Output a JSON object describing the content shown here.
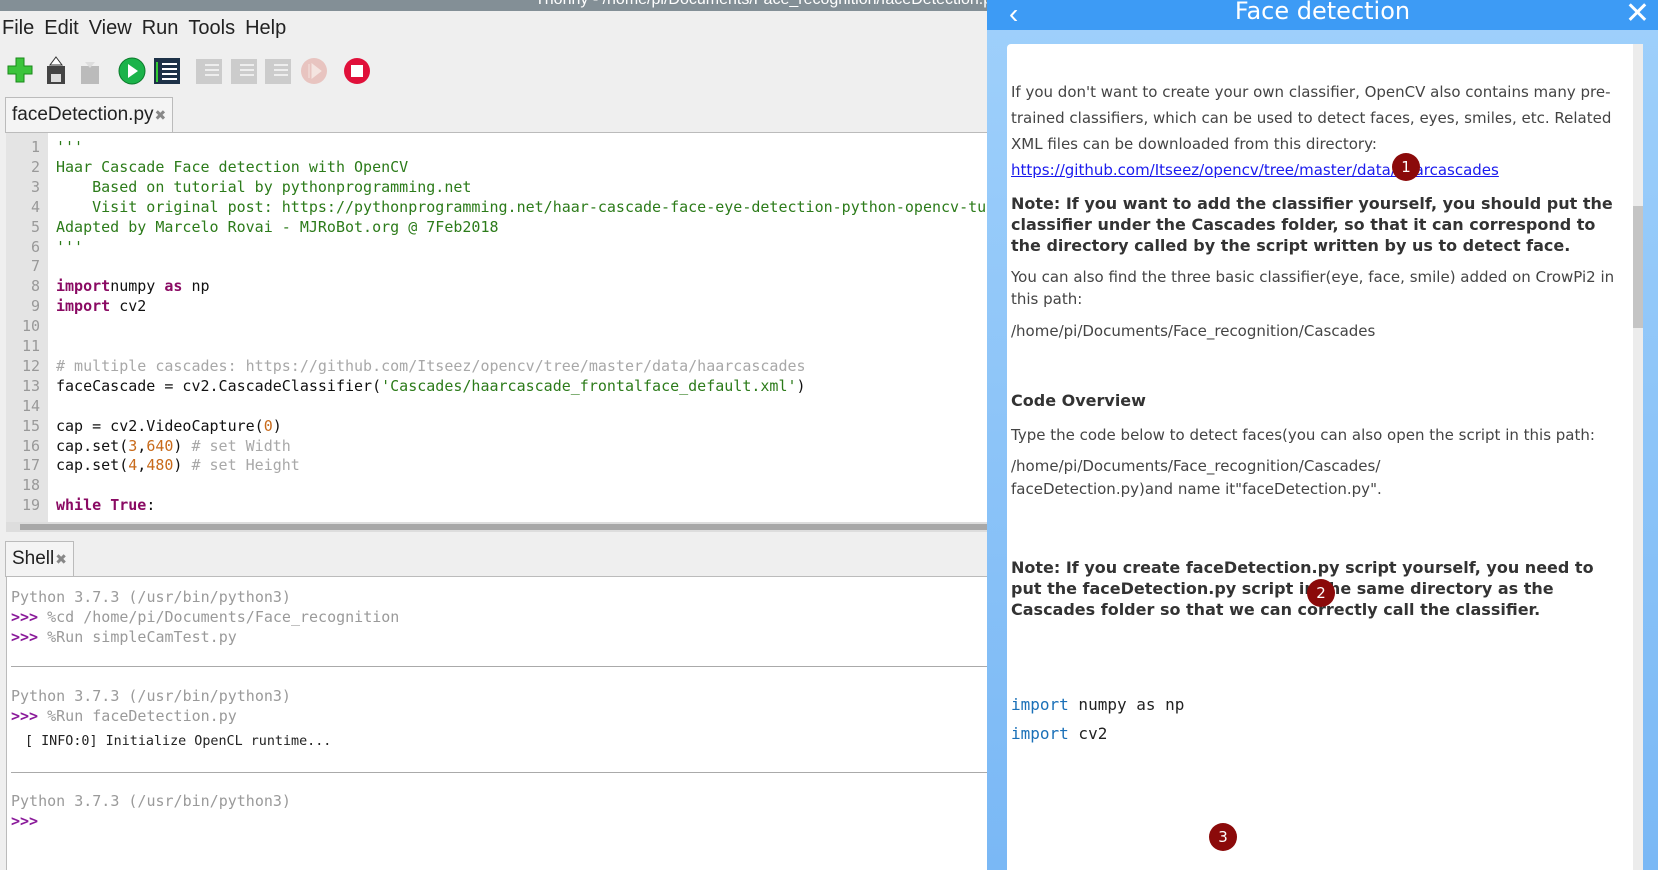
{
  "window": {
    "title": "Thonny - /home/pi/Documents/Face_recognition/faceDetection.py"
  },
  "menu": [
    "File",
    "Edit",
    "View",
    "Run",
    "Tools",
    "Help"
  ],
  "toolbar": [
    {
      "icon": "new-file-icon",
      "enabled": true
    },
    {
      "icon": "load-icon",
      "enabled": true
    },
    {
      "icon": "save-icon",
      "enabled": false
    },
    {
      "icon": "run-icon",
      "enabled": true
    },
    {
      "icon": "debug-icon",
      "enabled": true
    },
    {
      "icon": "step-over-icon",
      "enabled": false
    },
    {
      "icon": "step-into-icon",
      "enabled": false
    },
    {
      "icon": "step-out-icon",
      "enabled": false
    },
    {
      "icon": "resume-icon",
      "enabled": false
    },
    {
      "icon": "stop-icon",
      "enabled": true
    }
  ],
  "editor": {
    "tab_label": "faceDetection.py",
    "lines": [
      [
        [
          "str",
          "'''"
        ]
      ],
      [
        [
          "str",
          "Haar Cascade Face detection with OpenCV"
        ]
      ],
      [
        [
          "str",
          "    Based on tutorial by pythonprogramming.net"
        ]
      ],
      [
        [
          "str",
          "    Visit original post: https://pythonprogramming.net/haar-cascade-face-eye-detection-python-opencv-tutorial/"
        ]
      ],
      [
        [
          "str",
          "Adapted by Marcelo Rovai - MJRoBot.org @ 7Feb2018"
        ]
      ],
      [
        [
          "str",
          "'''"
        ]
      ],
      [],
      [
        [
          "kw",
          "import"
        ],
        [
          "",
          "numpy "
        ],
        [
          "kw",
          "as"
        ],
        [
          "",
          " np"
        ]
      ],
      [
        [
          "kw",
          "import"
        ],
        [
          "",
          " cv2"
        ]
      ],
      [],
      [],
      [
        [
          "cmt",
          "# multiple cascades: https://github.com/Itseez/opencv/tree/master/data/haarcascades"
        ]
      ],
      [
        [
          "",
          "faceCascade = cv2.CascadeClassifier("
        ],
        [
          "str",
          "'Cascades/haarcascade_frontalface_default.xml'"
        ],
        [
          "",
          ")"
        ]
      ],
      [],
      [
        [
          "",
          "cap = cv2.VideoCapture("
        ],
        [
          "num",
          "0"
        ],
        [
          "",
          ")"
        ]
      ],
      [
        [
          "",
          "cap.set("
        ],
        [
          "num",
          "3"
        ],
        [
          "",
          ","
        ],
        [
          "num",
          "640"
        ],
        [
          "",
          ") "
        ],
        [
          "cmt",
          "# set Width"
        ]
      ],
      [
        [
          "",
          "cap.set("
        ],
        [
          "num",
          "4"
        ],
        [
          "",
          ","
        ],
        [
          "num",
          "480"
        ],
        [
          "",
          ") "
        ],
        [
          "cmt",
          "# set Height"
        ]
      ],
      [],
      [
        [
          "kw",
          "while"
        ],
        [
          "",
          " "
        ],
        [
          "kw",
          "True"
        ],
        [
          "",
          ":"
        ]
      ]
    ]
  },
  "shell": {
    "tab_label": "Shell",
    "sessions": [
      {
        "lines": [
          {
            "text": "Python 3.7.3 (/usr/bin/python3)"
          },
          {
            "prompt": ">>> ",
            "text": "%cd /home/pi/Documents/Face_recognition"
          },
          {
            "prompt": ">>> ",
            "text": "%Run simpleCamTest.py"
          }
        ]
      },
      {
        "lines": [
          {
            "text": "Python 3.7.3 (/usr/bin/python3)"
          },
          {
            "prompt": ">>> ",
            "text": "%Run faceDetection.py"
          }
        ],
        "output": "[ INFO:0] Initialize OpenCL runtime..."
      },
      {
        "lines": [
          {
            "text": "Python 3.7.3 (/usr/bin/python3)"
          },
          {
            "prompt": ">>> ",
            "text": ""
          }
        ]
      }
    ]
  },
  "panel": {
    "title": "Face detection",
    "intro": "If you don't want to create your own classifier, OpenCV also contains many pre-trained classifiers, which can be used to detect faces, eyes, smiles, etc. Related XML files can be downloaded from this directory: ",
    "link": "https://github.com/Itseez/opencv/tree/master/data/haarcascades",
    "note1": "Note: If you want to add the classifier yourself, you should put the classifier under the Cascades folder, so that it can correspond to the directory called by the script written by us to detect face.",
    "para2": "You can also find the three basic classifier(eye, face, smile) added on CrowPi2 in this path:",
    "path1": "/home/pi/Documents/Face_recognition/Cascades",
    "heading": "Code Overview",
    "para3": "Type the code below to detect faces(you can also open the script in this path:",
    "path2": "/home/pi/Documents/Face_recognition/Cascades/ faceDetection.py)and name it\"faceDetection.py\".",
    "note2": "Note: If you create faceDetection.py script yourself, you need to put the faceDetection.py script in the same directory as the Cascades folder so that we can correctly call the classifier.",
    "code": [
      {
        "kw": "import",
        "rest": " numpy as np"
      },
      {
        "kw": "import",
        "rest": " cv2"
      }
    ],
    "badges": [
      "1",
      "2",
      "3"
    ],
    "accent": "#3d9bf5",
    "badge_color": "#8b0a0a"
  }
}
